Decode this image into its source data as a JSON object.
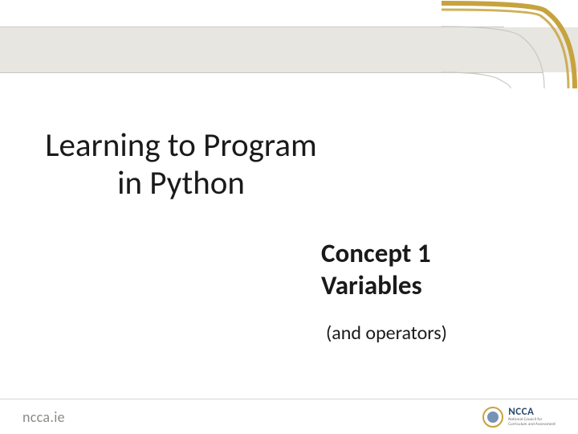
{
  "title_line1": "Learning to Program",
  "title_line2": "in Python",
  "concept_line1": "Concept 1",
  "concept_line2": "Variables",
  "subtitle": "(and operators)",
  "footer": {
    "left": "ncca.ie",
    "logo_text": "NCCA",
    "logo_sub1": "National Council for",
    "logo_sub2": "Curriculum and Assessment"
  },
  "colors": {
    "gold": "#c7a33e",
    "band": "#e7e6e1",
    "text": "#1a1a1a",
    "muted": "#8a8a86",
    "blue": "#2b4a6f"
  }
}
